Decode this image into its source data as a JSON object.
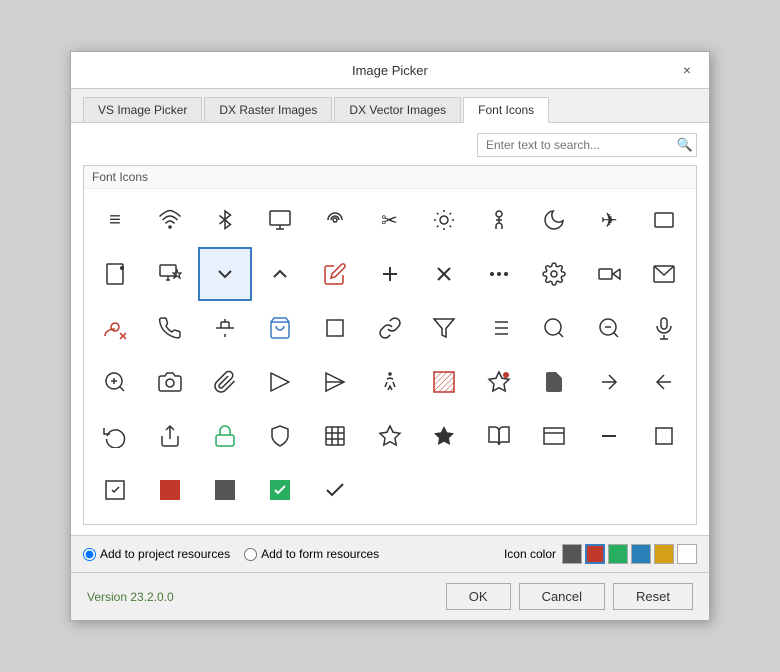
{
  "dialog": {
    "title": "Image Picker",
    "close_label": "×"
  },
  "tabs": [
    {
      "id": "vs-image-picker",
      "label": "VS Image Picker",
      "active": false
    },
    {
      "id": "dx-raster-images",
      "label": "DX Raster Images",
      "active": false
    },
    {
      "id": "dx-vector-images",
      "label": "DX Vector Images",
      "active": false
    },
    {
      "id": "font-icons",
      "label": "Font Icons",
      "active": true
    }
  ],
  "search": {
    "placeholder": "Enter text to search..."
  },
  "icon_panel": {
    "header": "Font Icons"
  },
  "bottom": {
    "radio1_label": "Add to project resources",
    "radio2_label": "Add to form resources",
    "color_label": "Icon color"
  },
  "footer": {
    "version": "Version 23.2.0.0",
    "ok_label": "OK",
    "cancel_label": "Cancel",
    "reset_label": "Reset"
  },
  "colors": [
    {
      "value": "#555555",
      "selected": false
    },
    {
      "value": "#c0392b",
      "selected": true
    },
    {
      "value": "#27ae60",
      "selected": false
    },
    {
      "value": "#2980b9",
      "selected": false
    },
    {
      "value": "#d4a017",
      "selected": false
    },
    {
      "value": "#ffffff",
      "selected": false
    }
  ],
  "selected_icon_index": 13
}
